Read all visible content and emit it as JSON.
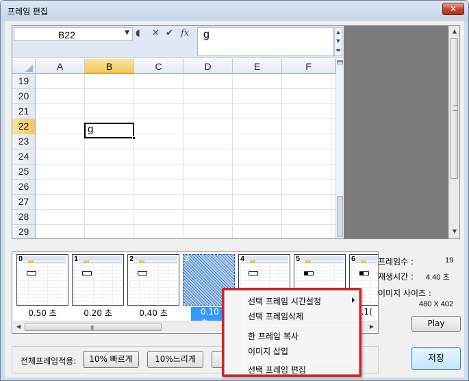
{
  "window": {
    "title": "프레임 편집",
    "close_label": "✕"
  },
  "excel": {
    "namebox": "B22",
    "formula": "g",
    "fx_icons": {
      "cancel": "✕",
      "enter": "✔",
      "fx": "fx"
    },
    "columns": [
      "A",
      "B",
      "C",
      "D",
      "E",
      "F"
    ],
    "active_column": "B",
    "rows": [
      "19",
      "20",
      "21",
      "22",
      "23",
      "24",
      "25",
      "26",
      "27",
      "28",
      "29"
    ],
    "active_row": "22",
    "active_cell_value": "g"
  },
  "filmstrip": {
    "frames": [
      {
        "index": "0",
        "time": "0.50 초"
      },
      {
        "index": "1",
        "time": "0.20 초"
      },
      {
        "index": "2",
        "time": "0.40 초"
      },
      {
        "index": "3",
        "time": "0.10 초",
        "selected": true
      },
      {
        "index": "4",
        "time": ""
      },
      {
        "index": "5",
        "time": ""
      },
      {
        "index": "6",
        "time": "0.1("
      }
    ],
    "scroll_grip": "III"
  },
  "info": {
    "frame_count_label": "프레임수 :",
    "frame_count_value": "19",
    "play_time_label": "재생시간 :",
    "play_time_value": "4.40 초",
    "image_size_label": "이미지 사이즈 :",
    "image_size_value": "480 X 402",
    "play_button": "Play",
    "save_button": "저장"
  },
  "bottom": {
    "apply_all_label": "전체프레임적용:",
    "faster_button": "10% 빠르게",
    "slower_button": "10%느리게"
  },
  "context_menu": {
    "items": [
      "선택 프레임 시간설정",
      "선택 프레임삭제",
      "한 프레임 복사",
      "이미지 삽입",
      "선택 프레임 편집"
    ]
  },
  "colors": {
    "highlight": "#e01d1d",
    "selection": "#3399ff",
    "excel_active_header": "#f5c85b"
  }
}
